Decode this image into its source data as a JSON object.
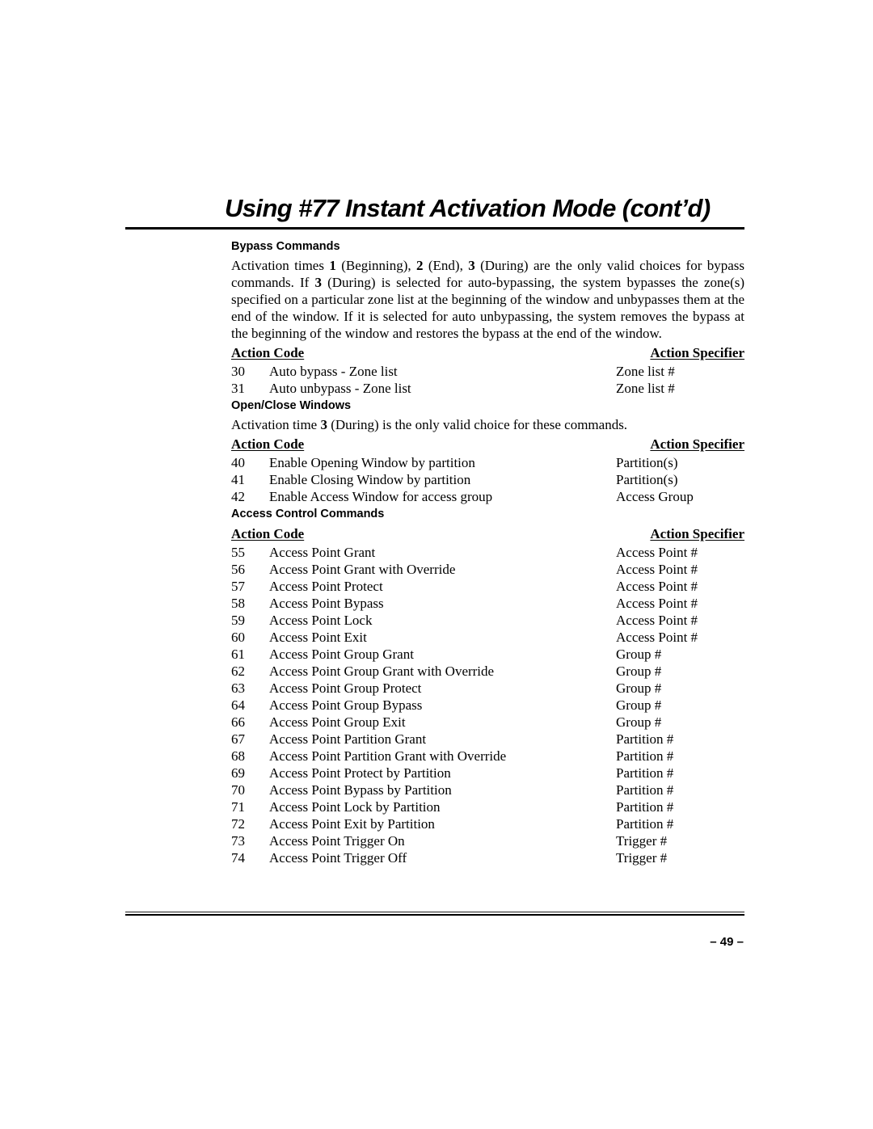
{
  "page": {
    "title": "Using #77 Instant Activation Mode (cont’d)",
    "page_number": "– 49 –"
  },
  "sections": [
    {
      "heading": "Bypass Commands",
      "paragraph": [
        {
          "t": "Activation times "
        },
        {
          "b": "1"
        },
        {
          "t": " (Beginning), "
        },
        {
          "b": "2"
        },
        {
          "t": " (End), "
        },
        {
          "b": "3"
        },
        {
          "t": " (During) are the only valid choices for bypass commands.  If "
        },
        {
          "b": "3"
        },
        {
          "t": " (During) is selected for auto-bypassing, the system bypasses the zone(s) specified on a particular zone list at the beginning of the window and unbypasses them at the end of the window.  If it is selected for auto unbypassing, the system removes the bypass at the beginning of the window and restores the bypass at the end of the window."
        }
      ],
      "table": {
        "header_code": "Action Code",
        "header_specifier": "Action Specifier",
        "rows": [
          {
            "code": "30",
            "description": "Auto bypass - Zone list",
            "specifier": "Zone list #"
          },
          {
            "code": "31",
            "description": "Auto unbypass - Zone list",
            "specifier": "Zone list #"
          }
        ]
      }
    },
    {
      "heading": "Open/Close Windows",
      "paragraph": [
        {
          "t": "Activation time "
        },
        {
          "b": "3"
        },
        {
          "t": " (During) is the only valid choice for these commands."
        }
      ],
      "table": {
        "header_code": "Action Code",
        "header_specifier": "Action Specifier",
        "rows": [
          {
            "code": "40",
            "description": "Enable Opening Window by partition",
            "specifier": "Partition(s)"
          },
          {
            "code": "41",
            "description": "Enable Closing Window by partition",
            "specifier": "Partition(s)"
          },
          {
            "code": "42",
            "description": "Enable Access Window for access group",
            "specifier": "Access Group"
          }
        ]
      }
    },
    {
      "heading": "Access Control Commands",
      "paragraph": [],
      "table": {
        "header_code": "Action Code",
        "header_specifier": "Action Specifier",
        "rows": [
          {
            "code": "55",
            "description": "Access Point Grant",
            "specifier": "Access Point #"
          },
          {
            "code": "56",
            "description": "Access Point Grant with Override",
            "specifier": "Access Point #"
          },
          {
            "code": "57",
            "description": "Access Point Protect",
            "specifier": "Access Point #"
          },
          {
            "code": "58",
            "description": "Access Point Bypass",
            "specifier": "Access Point #"
          },
          {
            "code": "59",
            "description": "Access Point Lock",
            "specifier": "Access Point #"
          },
          {
            "code": "60",
            "description": "Access Point Exit",
            "specifier": "Access Point #"
          },
          {
            "code": "61",
            "description": "Access Point Group Grant",
            "specifier": "Group #"
          },
          {
            "code": "62",
            "description": "Access Point Group Grant with Override",
            "specifier": "Group #"
          },
          {
            "code": "63",
            "description": "Access Point Group Protect",
            "specifier": "Group #"
          },
          {
            "code": "64",
            "description": "Access Point Group Bypass",
            "specifier": "Group #"
          },
          {
            "code": "66",
            "description": "Access Point Group Exit",
            "specifier": "Group #"
          },
          {
            "code": "67",
            "description": "Access Point Partition Grant",
            "specifier": "Partition #"
          },
          {
            "code": "68",
            "description": "Access Point Partition Grant with Override",
            "specifier": "Partition #"
          },
          {
            "code": "69",
            "description": "Access Point Protect by Partition",
            "specifier": "Partition #"
          },
          {
            "code": "70",
            "description": "Access Point Bypass by Partition",
            "specifier": "Partition #"
          },
          {
            "code": "71",
            "description": "Access Point Lock by Partition",
            "specifier": "Partition #"
          },
          {
            "code": "72",
            "description": "Access Point Exit by Partition",
            "specifier": "Partition #"
          },
          {
            "code": "73",
            "description": "Access Point Trigger On",
            "specifier": "Trigger #"
          },
          {
            "code": "74",
            "description": "Access Point Trigger Off",
            "specifier": "Trigger #"
          }
        ]
      }
    }
  ]
}
